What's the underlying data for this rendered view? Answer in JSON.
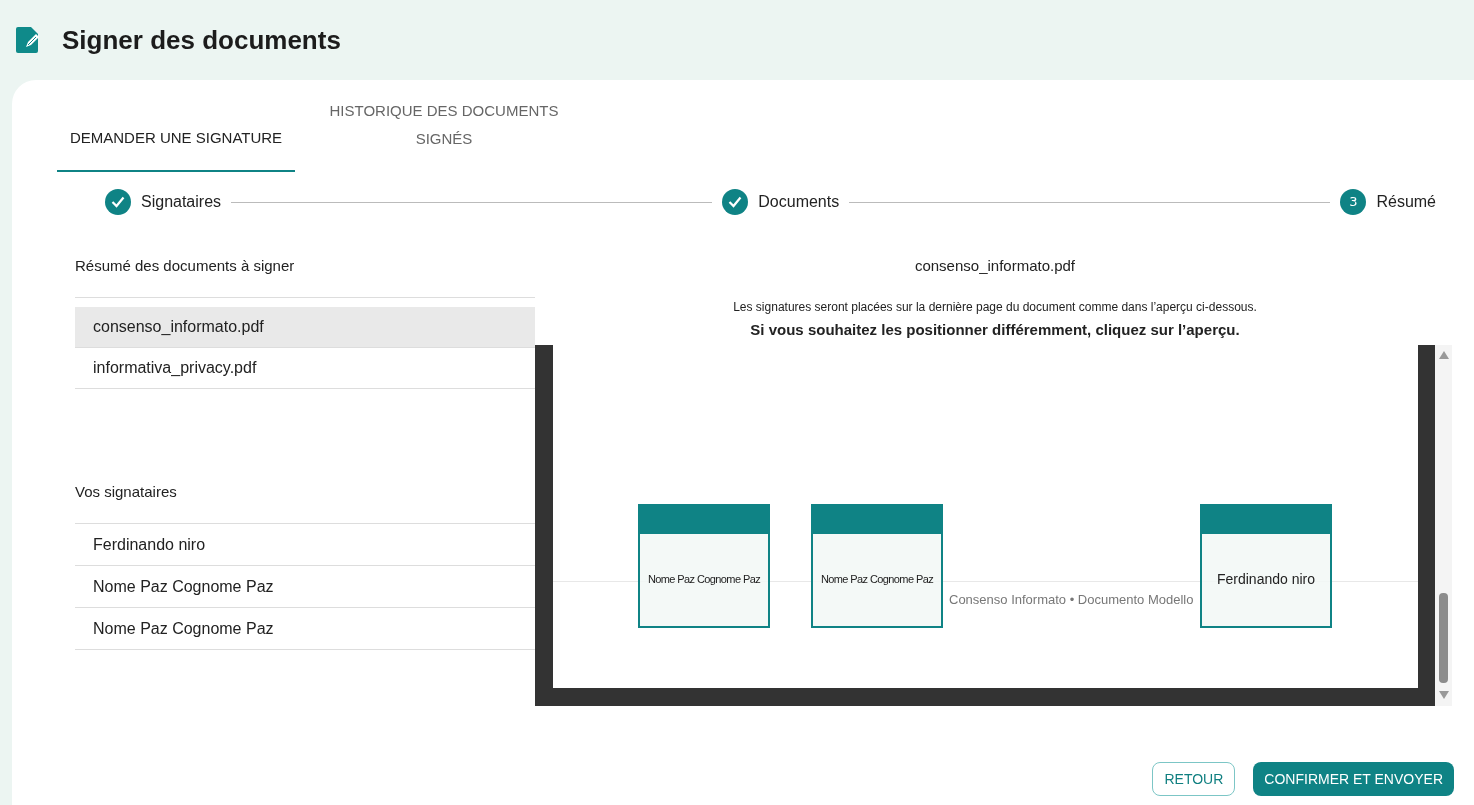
{
  "page_title": "Signer des documents",
  "tabs": [
    {
      "label": "DEMANDER UNE SIGNATURE",
      "selected": true
    },
    {
      "label": "HISTORIQUE DES DOCUMENTS SIGNÉS",
      "selected": false
    }
  ],
  "steps": [
    {
      "label": "Signataires",
      "done": true
    },
    {
      "label": "Documents",
      "done": true
    },
    {
      "label": "Résumé",
      "done": false,
      "number": "3"
    }
  ],
  "documents_heading": "Résumé des documents à signer",
  "documents": [
    {
      "name": "consenso_informato.pdf",
      "selected": true
    },
    {
      "name": "informativa_privacy.pdf",
      "selected": false
    }
  ],
  "signatories_heading": "Vos signataires",
  "signatories": [
    "Ferdinando niro",
    "Nome Paz Cognome Paz",
    "Nome Paz Cognome Paz"
  ],
  "preview": {
    "file_name": "consenso_informato.pdf",
    "note": "Les signatures seront placées sur la dernière page du document comme dans l’aperçu ci-dessous.",
    "instruction": "Si vous souhaitez les positionner différemment, cliquez sur l’aperçu.",
    "footer_text": "Consenso Informato • Documento Modello",
    "signature_boxes": [
      {
        "name": "Nome Paz Cognome Paz",
        "condensed": true
      },
      {
        "name": "Nome Paz Cognome Paz",
        "condensed": true
      },
      {
        "name": "Ferdinando niro",
        "condensed": false
      }
    ]
  },
  "buttons": {
    "back": "RETOUR",
    "confirm": "CONFIRMER ET ENVOYER"
  }
}
